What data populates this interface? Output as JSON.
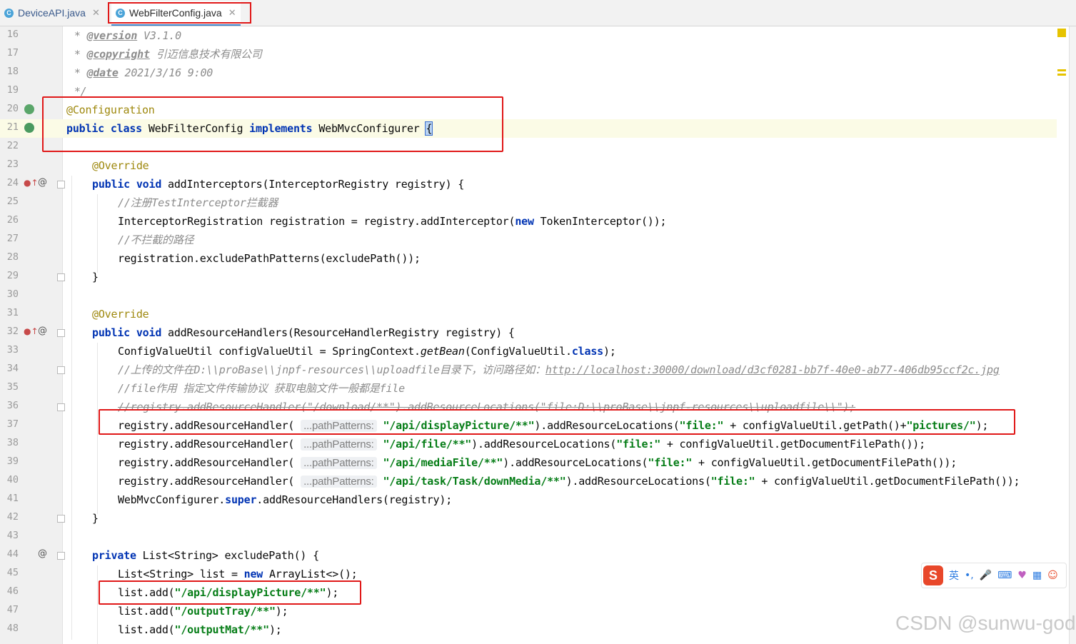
{
  "tabs": [
    {
      "label": "DeviceAPI.java",
      "icon": "C"
    },
    {
      "label": "WebFilterConfig.java",
      "icon": "C"
    }
  ],
  "lines": {
    "l16": {
      "num": "16",
      "a": " * ",
      "b": "@version",
      "c": " V3.1.0"
    },
    "l17": {
      "num": "17",
      "a": " * ",
      "b": "@copyright",
      "c": " 引迈信息技术有限公司"
    },
    "l18": {
      "num": "18",
      "a": " * ",
      "b": "@date",
      "c": " 2021/3/16 9:00"
    },
    "l19": {
      "num": "19",
      "a": " */"
    },
    "l20": {
      "num": "20",
      "a": "@Configuration"
    },
    "l21": {
      "num": "21",
      "kw1": "public",
      "kw2": "class",
      "a": "WebFilterConfig",
      "kw3": "implements",
      "b": "WebMvcConfigurer",
      "brace": "{"
    },
    "l22": {
      "num": "22"
    },
    "l23": {
      "num": "23",
      "a": "@Override"
    },
    "l24": {
      "num": "24",
      "kw1": "public",
      "kw2": "void",
      "a": "addInterceptors(InterceptorRegistry registry) {"
    },
    "l25": {
      "num": "25",
      "a": "//注册TestInterceptor拦截器"
    },
    "l26": {
      "num": "26",
      "a": "InterceptorRegistration registration = registry.addInterceptor(",
      "kw1": "new",
      "b": " TokenInterceptor());"
    },
    "l27": {
      "num": "27",
      "a": "//不拦截的路径"
    },
    "l28": {
      "num": "28",
      "a": "registration.excludePathPatterns(excludePath());"
    },
    "l29": {
      "num": "29",
      "a": "}"
    },
    "l30": {
      "num": "30"
    },
    "l31": {
      "num": "31",
      "a": "@Override"
    },
    "l32": {
      "num": "32",
      "kw1": "public",
      "kw2": "void",
      "a": "addResourceHandlers(ResourceHandlerRegistry registry) {"
    },
    "l33": {
      "num": "33",
      "a": "ConfigValueUtil configValueUtil = SpringContext.",
      "b": "getBean",
      "c": "(ConfigValueUtil.",
      "kw1": "class",
      "d": ");"
    },
    "l34": {
      "num": "34",
      "a": "//上传的文件在D:\\\\proBase\\\\jnpf-resources\\\\uploadfile目录下，访问路径如：",
      "url": "http://localhost:30000/download/d3cf0281-bb7f-40e0-ab77-406db95ccf2c.jpg"
    },
    "l35": {
      "num": "35",
      "a": "//file作用 指定文件传输协议 获取电脑文件一般都是file"
    },
    "l36": {
      "num": "36",
      "a": "//registry.addResourceHandler(\"/download/**\").addResourceLocations(\"file:D:\\\\proBase\\\\jnpf-resources\\\\uploadfile\\\\\");"
    },
    "l37": {
      "num": "37",
      "a": "registry.addResourceHandler( ",
      "hint": "...pathPatterns:",
      "s1": "\"/api/displayPicture/**\"",
      "b": ").addResourceLocations(",
      "s2": "\"file:\"",
      "c": " + configValueUtil.getPath()+",
      "s3": "\"pictures/\"",
      "d": ");"
    },
    "l38": {
      "num": "38",
      "a": "registry.addResourceHandler( ",
      "hint": "...pathPatterns:",
      "s1": "\"/api/file/**\"",
      "b": ").addResourceLocations(",
      "s2": "\"file:\"",
      "c": " + configValueUtil.getDocumentFilePath());"
    },
    "l39": {
      "num": "39",
      "a": "registry.addResourceHandler( ",
      "hint": "...pathPatterns:",
      "s1": "\"/api/mediaFile/**\"",
      "b": ").addResourceLocations(",
      "s2": "\"file:\"",
      "c": " + configValueUtil.getDocumentFilePath());"
    },
    "l40": {
      "num": "40",
      "a": "registry.addResourceHandler( ",
      "hint": "...pathPatterns:",
      "s1": "\"/api/task/Task/downMedia/**\"",
      "b": ").addResourceLocations(",
      "s2": "\"file:\"",
      "c": " + configValueUtil.getDocumentFilePath());"
    },
    "l41": {
      "num": "41",
      "a": "WebMvcConfigurer.",
      "kw1": "super",
      "b": ".addResourceHandlers(registry);"
    },
    "l42": {
      "num": "42",
      "a": "}"
    },
    "l43": {
      "num": "43"
    },
    "l44": {
      "num": "44",
      "kw1": "private",
      "a": " List<String> excludePath() {"
    },
    "l45": {
      "num": "45",
      "a": "List<String> list = ",
      "kw1": "new",
      "b": " ArrayList<>();"
    },
    "l46": {
      "num": "46",
      "a": "list.add(",
      "s1": "\"/api/displayPicture/**\"",
      "b": ");"
    },
    "l47": {
      "num": "47",
      "a": "list.add(",
      "s1": "\"/outputTray/**\"",
      "b": ");"
    },
    "l48": {
      "num": "48",
      "a": "list.add(",
      "s1": "\"/outputMat/**\"",
      "b": ");"
    }
  },
  "ime": {
    "logo": "S",
    "lang": "英",
    "punct": "•,"
  },
  "watermark": "CSDN @sunwu-god",
  "colors": {
    "keyword": "#0033b3",
    "string": "#067d17",
    "annotation": "#9e880d",
    "comment": "#8c8c8c",
    "highlight_box": "#e01818"
  }
}
